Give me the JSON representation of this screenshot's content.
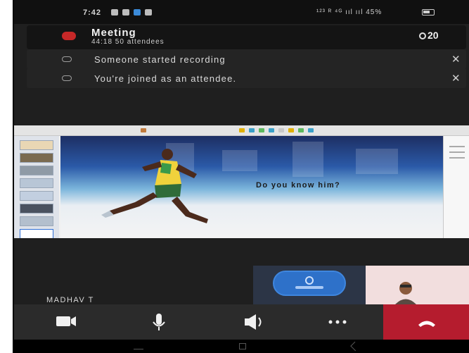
{
  "status_bar": {
    "time": "7:42",
    "right": "¹²³ ᴿ ⁴ᴳ ııl ııl 45% "
  },
  "meeting": {
    "title": "Meeting",
    "subtitle": "44:18  50 attendees",
    "participant_count": "20"
  },
  "notifications": [
    {
      "text": "Someone started recording",
      "close": "✕"
    },
    {
      "text": "You're joined as an attendee.",
      "close": "✕"
    }
  ],
  "slide": {
    "text": "Do you know him?"
  },
  "video": {
    "speaker_name": "MADHAV T"
  },
  "colors": {
    "leave": "#b51c2e",
    "record": "#c62828",
    "avatar": "#2e71c9"
  },
  "controls": {
    "camera": "camera-icon",
    "mic": "microphone-icon",
    "speaker": "speaker-icon",
    "more": "more-icon",
    "leave": "hang-up-icon"
  }
}
